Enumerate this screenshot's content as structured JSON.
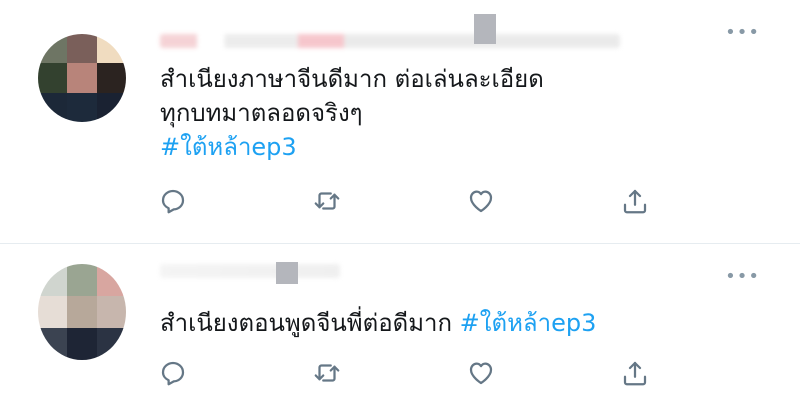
{
  "tweets": [
    {
      "text_line1": "สำเนียงภาษาจีนดีมาก ต่อเล่นละเอียด",
      "text_line2": "ทุกบทมาตลอดจริงๆ",
      "hashtag": "#ใต้หล้าep3",
      "more": "•••"
    },
    {
      "text": "สำเนียงตอนพูดจีนพี่ต่อดีมาก ",
      "hashtag": "#ใต้หล้าep3",
      "more": "•••"
    }
  ],
  "colors": {
    "hashtag": "#1da1f2",
    "icon": "#657786",
    "divider": "#e6ecf0"
  },
  "icons": [
    "reply-icon",
    "retweet-icon",
    "like-icon",
    "share-icon"
  ]
}
